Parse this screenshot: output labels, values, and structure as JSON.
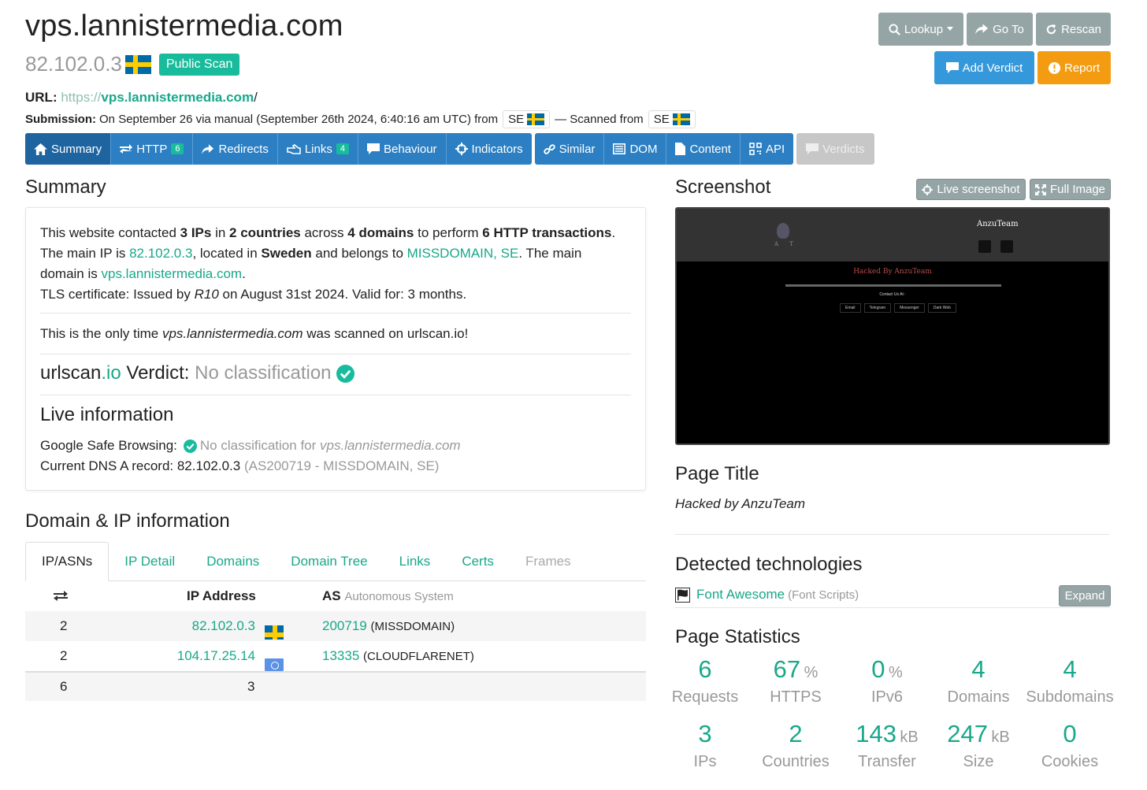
{
  "header": {
    "title": "vps.lannistermedia.com",
    "ip": "82.102.0.3",
    "badge": "Public Scan",
    "url_label": "URL:",
    "url_scheme": "https://",
    "url_domain": "vps.lannistermedia.com",
    "url_path": "/",
    "submission_label": "Submission:",
    "submission_text": "On September 26 via manual (September 26th 2024, 6:40:16 am UTC) from",
    "submission_cc": "SE",
    "scanned_from_text": "— Scanned from",
    "scanned_from_cc": "SE"
  },
  "actions": {
    "lookup": "Lookup",
    "goto": "Go To",
    "rescan": "Rescan",
    "add_verdict": "Add Verdict",
    "report": "Report"
  },
  "nav": {
    "summary": "Summary",
    "http": "HTTP",
    "http_count": "6",
    "redirects": "Redirects",
    "links": "Links",
    "links_count": "4",
    "behaviour": "Behaviour",
    "indicators": "Indicators",
    "similar": "Similar",
    "dom": "DOM",
    "content": "Content",
    "api": "API",
    "verdicts": "Verdicts"
  },
  "summary": {
    "heading": "Summary",
    "p1_a": "This website contacted ",
    "p1_ips": "3 IPs",
    "p1_b": " in ",
    "p1_countries": "2 countries",
    "p1_c": " across ",
    "p1_domains": "4 domains",
    "p1_d": " to perform ",
    "p1_tx": "6 HTTP transactions",
    "p1_e": ".",
    "p2_a": "The main IP is ",
    "p2_ip": "82.102.0.3",
    "p2_b": ", located in ",
    "p2_country": "Sweden",
    "p2_c": " and belongs to ",
    "p2_asn": "MISSDOMAIN, SE",
    "p2_d": ". The main",
    "p3_a": "domain is ",
    "p3_domain": "vps.lannistermedia.com",
    "p3_b": ".",
    "tls_a": "TLS certificate: Issued by ",
    "tls_issuer": "R10",
    "tls_b": " on August 31st 2024. Valid for: 3 months.",
    "only_a": "This is the only time ",
    "only_domain": "vps.lannistermedia.com",
    "only_b": " was scanned on urlscan.io!",
    "verdict_brand": "urlscan",
    "verdict_io": ".io",
    "verdict_label": " Verdict: ",
    "verdict_value": "No classification",
    "live_heading": "Live information",
    "gsb_label": "Google Safe Browsing:",
    "gsb_value": "No classification for ",
    "gsb_domain": "vps.lannistermedia.com",
    "dns_label": "Current DNS A record: 82.102.0.3",
    "dns_asn": "(AS200719 - MISSDOMAIN, SE)"
  },
  "domain_ip": {
    "heading": "Domain & IP information",
    "tabs": [
      "IP/ASNs",
      "IP Detail",
      "Domains",
      "Domain Tree",
      "Links",
      "Certs",
      "Frames"
    ],
    "col_ip": "IP Address",
    "col_as": "AS",
    "col_as_sub": "Autonomous System",
    "rows": [
      {
        "count": "2",
        "ip": "82.102.0.3",
        "asn": "200719",
        "asname": "(MISSDOMAIN)"
      },
      {
        "count": "2",
        "ip": "104.17.25.14",
        "asn": "13335",
        "asname": "(CLOUDFLARENET)"
      }
    ],
    "total_count": "6",
    "total_ips": "3"
  },
  "screenshot": {
    "heading": "Screenshot",
    "live_btn": "Live screenshot",
    "full_btn": "Full Image",
    "site_brand": "AnzuTeam",
    "site_logo_text": "A T",
    "site_hacked": "Hacked By AnzuTeam",
    "site_contact": "Contact Us At :",
    "site_links": [
      "Email",
      "Telegram",
      "Messenger",
      "Dark Web"
    ]
  },
  "page_title": {
    "heading": "Page Title",
    "value": "Hacked by AnzuTeam"
  },
  "tech": {
    "heading": "Detected technologies",
    "name": "Font Awesome",
    "category": "(Font Scripts)",
    "expand": "Expand"
  },
  "stats": {
    "heading": "Page Statistics",
    "items": [
      {
        "num": "6",
        "unit": "",
        "label": "Requests"
      },
      {
        "num": "67",
        "unit": "%",
        "label": "HTTPS"
      },
      {
        "num": "0",
        "unit": "%",
        "label": "IPv6"
      },
      {
        "num": "4",
        "unit": "",
        "label": "Domains"
      },
      {
        "num": "4",
        "unit": "",
        "label": "Subdomains"
      },
      {
        "num": "3",
        "unit": "",
        "label": "IPs"
      },
      {
        "num": "2",
        "unit": "",
        "label": "Countries"
      },
      {
        "num": "143",
        "unit": "kB",
        "label": "Transfer"
      },
      {
        "num": "247",
        "unit": "kB",
        "label": "Size"
      },
      {
        "num": "0",
        "unit": "",
        "label": "Cookies"
      }
    ]
  }
}
